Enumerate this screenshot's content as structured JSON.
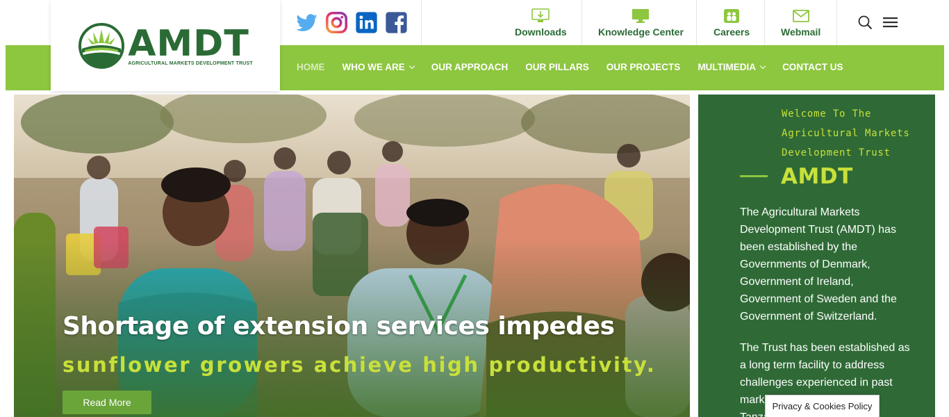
{
  "brand": {
    "logo_text": "AMDT",
    "logo_subtitle": "AGRICULTURAL MARKETS DEVELOPMENT TRUST",
    "primary_color": "#2a6b35",
    "accent_color": "#8dc63f",
    "highlight_color": "#c8e03a"
  },
  "social": [
    "twitter-icon",
    "instagram-icon",
    "linkedin-icon",
    "facebook-icon"
  ],
  "utility": {
    "downloads": "Downloads",
    "knowledge": "Knowledge Center",
    "careers": "Careers",
    "webmail": "Webmail"
  },
  "nav": {
    "home": "HOME",
    "who": "WHO WE ARE",
    "approach": "OUR APPROACH",
    "pillars": "OUR PILLARS",
    "projects": "OUR PROJECTS",
    "multimedia": "MULTIMEDIA",
    "contact": "CONTACT US"
  },
  "hero": {
    "title": "Shortage of extension services impedes",
    "subtitle": "sunflower growers achieve high productivity.",
    "button": "Read More"
  },
  "side": {
    "welcome": "Welcome To The Agricultural Markets Development Trust",
    "title": "AMDT",
    "p1": "The Agricultural Markets Development Trust (AMDT) has been established by the Governments of Denmark, Government of Ireland, Government of Sweden and the Government of Switzerland.",
    "p2": "The Trust has been established as a long term facility to address challenges experienced in past market systems initiatives in Tanzania."
  },
  "cookie": "Privacy & Cookies Policy"
}
